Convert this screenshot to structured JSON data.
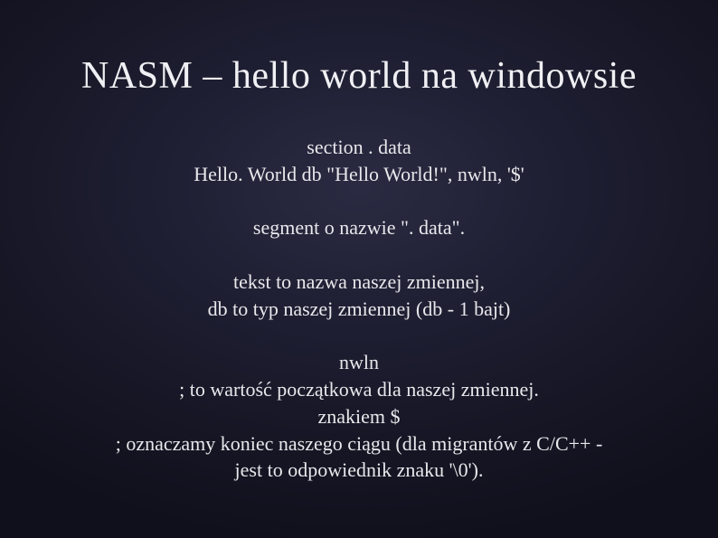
{
  "title": "NASM – hello world na windowsie",
  "block1_line1": "section . data",
  "block1_line2": "Hello. World db \"Hello World!\", nwln, '$'",
  "block2_line1": "segment o nazwie \". data\".",
  "block3_line1": "tekst to nazwa naszej zmiennej,",
  "block3_line2": "db to typ naszej zmiennej (db - 1 bajt)",
  "block4_line1": "nwln",
  "block4_line2": "; to wartość początkowa dla naszej zmiennej.",
  "block4_line3": "znakiem $",
  "block4_line4": "; oznaczamy koniec naszego ciągu (dla migrantów z C/C++ -",
  "block4_line5": "jest to odpowiednik znaku '\\0')."
}
